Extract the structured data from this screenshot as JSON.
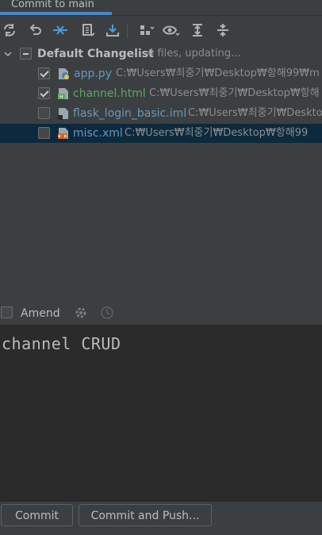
{
  "tab": {
    "label": "Commit to main"
  },
  "toolbar": {
    "buttons": [
      "refresh-icon",
      "rollback-icon",
      "merge-icon",
      "diff-icon",
      "update-icon",
      "group-by-icon",
      "eye-icon",
      "expand-all-icon",
      "collapse-all-icon"
    ]
  },
  "changelist": {
    "name": "Default Changelist",
    "status": "4 files, updating...",
    "files": [
      {
        "name": "app.py",
        "path": "C:₩Users₩최중기₩Desktop₩항해99₩m",
        "checked": true,
        "color": "#6897bb",
        "icon": "python-file-icon"
      },
      {
        "name": "channel.html",
        "path": "C:₩Users₩최중기₩Desktop₩항해",
        "checked": true,
        "color": "#62a362",
        "icon": "html-file-icon"
      },
      {
        "name": "flask_login_basic.iml",
        "path": "C:₩Users₩최중기₩Deskto",
        "checked": false,
        "color": "#6897bb",
        "icon": "module-file-icon"
      },
      {
        "name": "misc.xml",
        "path": "C:₩Users₩최중기₩Desktop₩항해99",
        "checked": false,
        "color": "#6897bb",
        "icon": "xml-file-icon"
      }
    ]
  },
  "amend": {
    "label": "Amend",
    "checked": false
  },
  "commit_message": "channel CRUD",
  "buttons": {
    "commit": "Commit",
    "commit_push": "Commit and Push..."
  }
}
